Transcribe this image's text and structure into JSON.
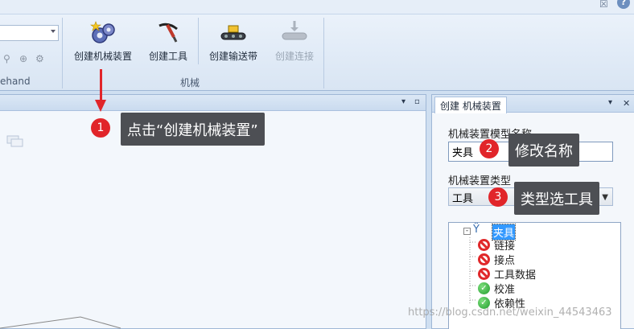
{
  "ribbon": {
    "left_group_label": "ehand",
    "group_label": "机械",
    "buttons": [
      {
        "label": "创建机械装置",
        "icon": "gears-icon",
        "enabled": true
      },
      {
        "label": "创建工具",
        "icon": "tool-icon",
        "enabled": true
      },
      {
        "label": "创建输送带",
        "icon": "conveyor-icon",
        "enabled": true
      },
      {
        "label": "创建连接",
        "icon": "connect-icon",
        "enabled": false
      }
    ],
    "close_glyph": "☒",
    "help_glyph": "?"
  },
  "left_panel": {
    "pin_glyph": "▾",
    "max_glyph": "▫"
  },
  "right_panel": {
    "tab_title": "创建 机械装置",
    "dropdown_glyph": "▾",
    "close_glyph": "✕",
    "name_label": "机械装置模型名称",
    "name_value": "夹具",
    "type_label": "机械装置类型",
    "type_value": "工具",
    "tree": {
      "root": "夹具",
      "children": [
        {
          "label": "链接",
          "status": "error"
        },
        {
          "label": "接点",
          "status": "error"
        },
        {
          "label": "工具数据",
          "status": "error"
        },
        {
          "label": "校准",
          "status": "ok"
        },
        {
          "label": "依赖性",
          "status": "ok"
        }
      ]
    }
  },
  "annotations": [
    {
      "number": "1",
      "text": "点击“创建机械装置”"
    },
    {
      "number": "2",
      "text": "修改名称"
    },
    {
      "number": "3",
      "text": "类型选工具"
    }
  ],
  "watermark": "https://blog.csdn.net/weixin_44543463",
  "colors": {
    "badge": "#e1252a",
    "callout_bg": "#4d4f54",
    "selection": "#3399ff"
  }
}
